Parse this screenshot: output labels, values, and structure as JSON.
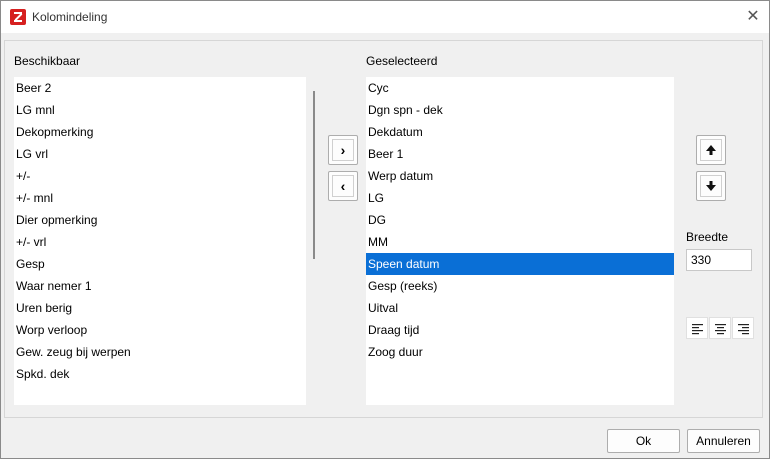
{
  "window": {
    "title": "Kolomindeling",
    "close_glyph": "✕"
  },
  "available": {
    "label": "Beschikbaar",
    "items": [
      "Beer 2",
      "LG mnl",
      "Dekopmerking",
      "LG vrl",
      "+/-",
      "+/- mnl",
      "Dier opmerking",
      "+/- vrl",
      "Gesp",
      "Waar nemer 1",
      "Uren berig",
      "Worp verloop",
      "Gew. zeug bij werpen",
      "Spkd. dek"
    ]
  },
  "selected": {
    "label": "Geselecteerd",
    "items": [
      "Cyc",
      "Dgn spn - dek",
      "Dekdatum",
      "Beer 1",
      "Werp datum",
      "LG",
      "DG",
      "MM",
      "Speen datum",
      "Gesp (reeks)",
      "Uitval",
      "Draag tijd",
      "Zoog duur"
    ],
    "selected_item": "Speen datum"
  },
  "transfer": {
    "add_glyph": "›",
    "remove_glyph": "‹"
  },
  "order": {
    "up_icon": "arrow-up-icon",
    "down_icon": "arrow-down-icon"
  },
  "width": {
    "label": "Breedte",
    "value": "330"
  },
  "alignment": {
    "icons": [
      "align-left-icon",
      "align-center-icon",
      "align-right-icon"
    ]
  },
  "footer": {
    "ok_label": "Ok",
    "cancel_label": "Annuleren"
  },
  "colors": {
    "selection": "#0a6fd6",
    "app_icon": "#d62020"
  }
}
